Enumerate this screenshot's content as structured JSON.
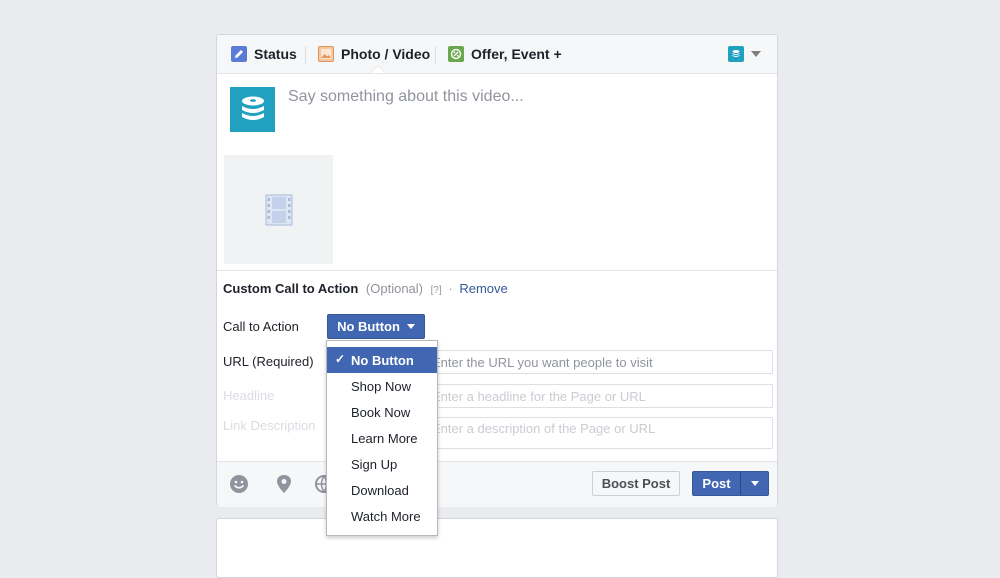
{
  "tabs": [
    {
      "label": "Status",
      "icon": "pencil-icon"
    },
    {
      "label": "Photo / Video",
      "icon": "photo-icon"
    },
    {
      "label": "Offer, Event +",
      "icon": "offer-icon"
    }
  ],
  "composer": {
    "placeholder": "Say something about this video...",
    "attachment_icon": "film-icon"
  },
  "cta": {
    "heading": "Custom Call to Action",
    "optional": "(Optional)",
    "help": "[?]",
    "separator": "·",
    "remove": "Remove",
    "call_label": "Call to Action",
    "selected": "No Button",
    "url_label": "URL (Required)",
    "url_placeholder": "Enter the URL you want people to visit",
    "headline_label": "Headline",
    "headline_placeholder": "Enter a headline for the Page or URL",
    "desc_label": "Link Description",
    "desc_placeholder": "Enter a description of the Page or URL"
  },
  "dropdown": {
    "options": [
      "No Button",
      "Shop Now",
      "Book Now",
      "Learn More",
      "Sign Up",
      "Download",
      "Watch More"
    ],
    "checkmark": "✓"
  },
  "footer": {
    "icons": [
      "smiley-icon",
      "location-pin-icon",
      "globe-icon"
    ],
    "boost": "Boost Post",
    "post": "Post"
  },
  "colors": {
    "accent": "#4267b2",
    "avatar": "#21a0c0",
    "link": "#365899",
    "background": "#e9ebee"
  }
}
